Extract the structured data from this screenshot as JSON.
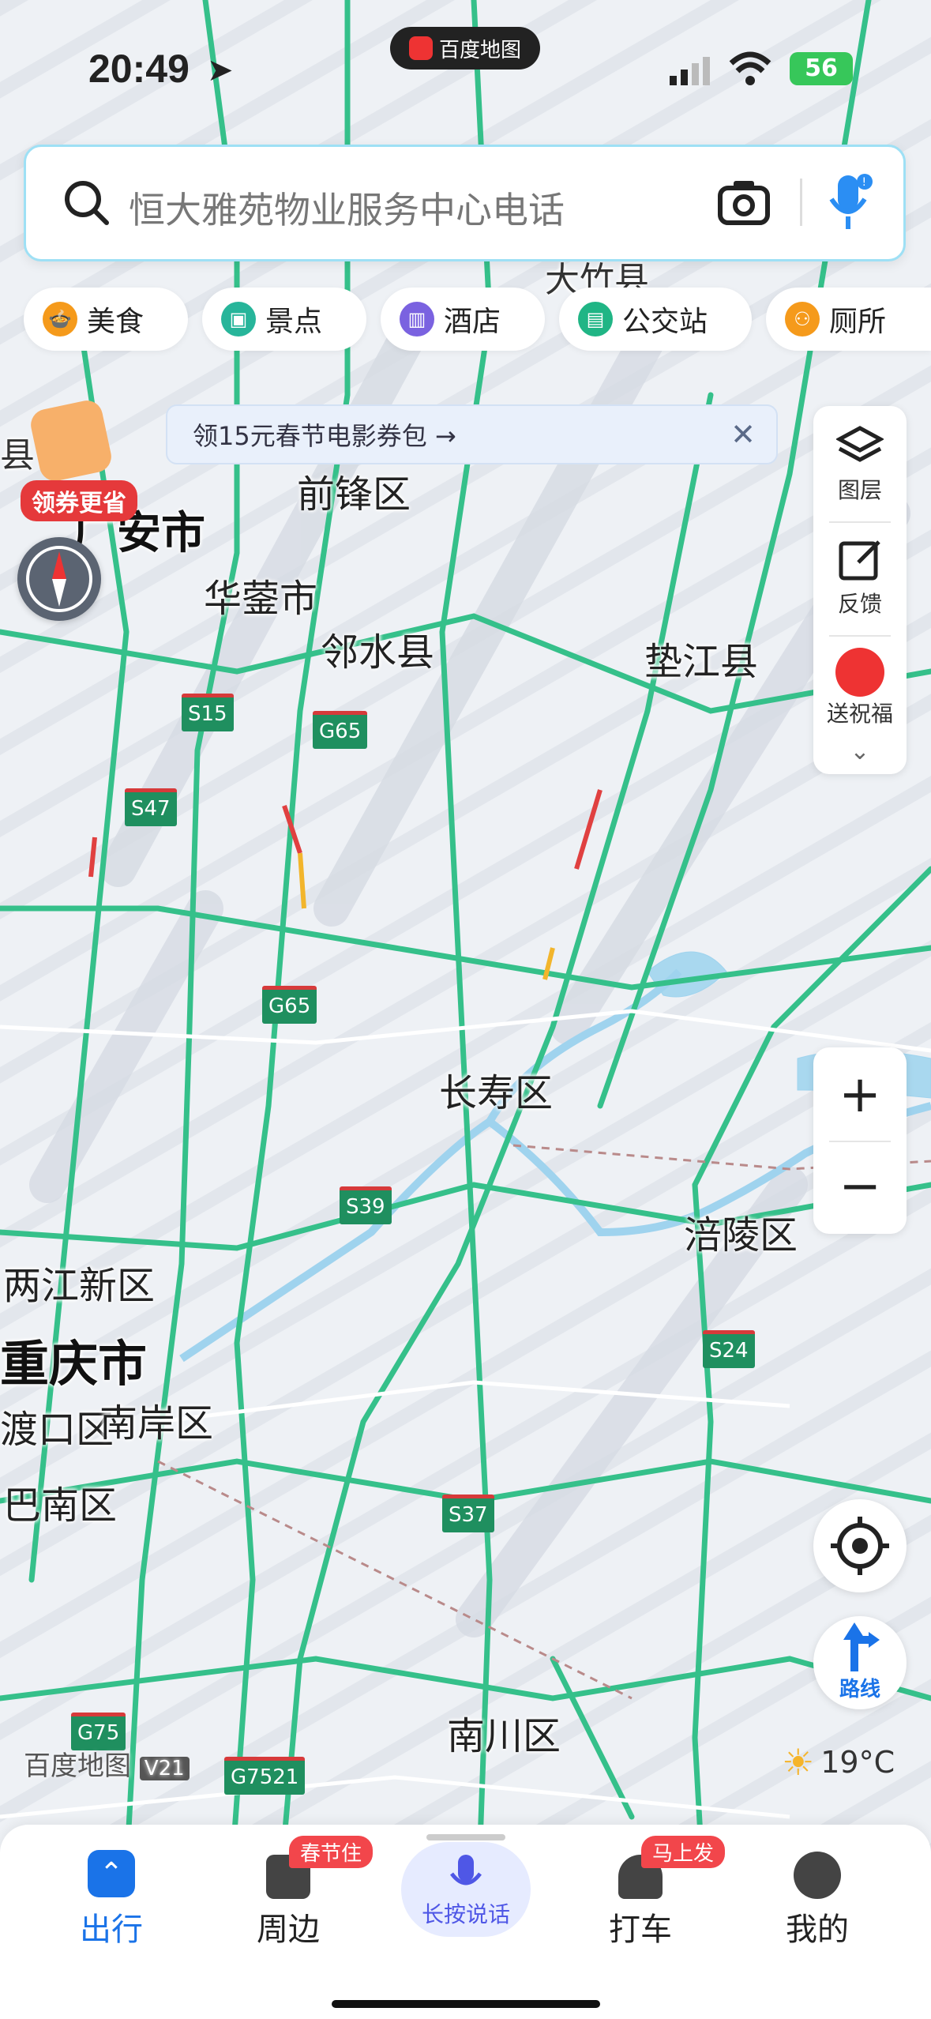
{
  "status_bar": {
    "time": "20:49",
    "app_name": "百度地图",
    "battery": "56"
  },
  "search": {
    "placeholder": "恒大雅苑物业服务中心电话"
  },
  "categories": [
    {
      "label": "美食",
      "color": "#f59a1b"
    },
    {
      "label": "景点",
      "color": "#27b59a"
    },
    {
      "label": "酒店",
      "color": "#7a62e0"
    },
    {
      "label": "公交站",
      "color": "#20b585"
    },
    {
      "label": "厕所",
      "color": "#f59a1b"
    }
  ],
  "banner": {
    "text": "领15元春节电影券包 →"
  },
  "coupon_badge": "领券更省",
  "side_tools": {
    "layers": "图层",
    "feedback": "反馈",
    "blessing": "送祝福"
  },
  "route_button": "路线",
  "weather": "19°C",
  "watermark": "百度地图",
  "watermark_version": "V21",
  "map_labels": {
    "guang_an": "广安市",
    "qianfeng": "前锋区",
    "huaying": "华蓥市",
    "linshui": "邻水县",
    "dianjiang": "垫江县",
    "changshou": "长寿区",
    "fuling": "涪陵区",
    "liangjiang": "两江新区",
    "chongqing": "重庆市",
    "nanan": "南岸区",
    "yuzhong": "渡口区",
    "banan": "巴南区",
    "nanchuan": "南川区",
    "dazhu": "大竹县",
    "left_county": "县"
  },
  "road_shields": {
    "s15": "S15",
    "g65a": "G65",
    "s47": "S47",
    "g65b": "G65",
    "s39": "S39",
    "s24": "S24",
    "s37": "S37",
    "g75": "G75",
    "g7521": "G7521"
  },
  "tabs": [
    {
      "label": "出行",
      "active": true
    },
    {
      "label": "周边",
      "badge": "春节住"
    },
    {
      "label": "长按说话"
    },
    {
      "label": "打车",
      "badge": "马上发"
    },
    {
      "label": "我的"
    }
  ],
  "colors": {
    "accent": "#1a73e8",
    "road": "#35c08a",
    "water": "#9fd3ee"
  }
}
